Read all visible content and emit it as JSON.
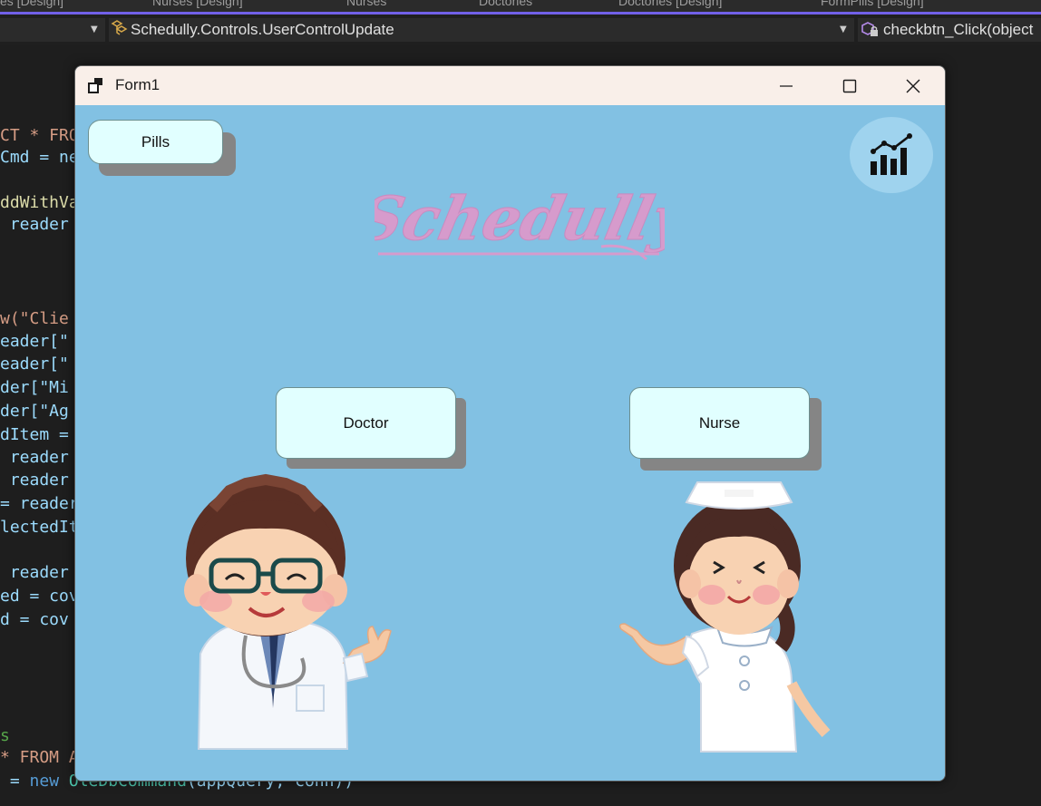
{
  "ide": {
    "tabs": [
      "es [Design]",
      "Nurses [Design]",
      "Nurses",
      "Doctories",
      "Doctories [Design]",
      "FormPills [Design]"
    ],
    "nav": {
      "left_combo": "",
      "middle_combo": "Schedully.Controls.UserControlUpdate",
      "right_combo": "checkbtn_Click(object"
    },
    "code_lines": [
      {
        "text": "CT * FRO",
        "cls": "sql"
      },
      {
        "text": "Cmd = ne",
        "cls": "id"
      },
      {
        "text": "ddWithVa",
        "cls": "fn"
      },
      {
        "text": " reader",
        "cls": "id"
      },
      {
        "text": "w(\"Clie",
        "cls": "str"
      },
      {
        "text": "eader[\"",
        "cls": "id"
      },
      {
        "text": "eader[\"",
        "cls": "id"
      },
      {
        "text": "der[\"Mi",
        "cls": "id"
      },
      {
        "text": "der[\"Ag",
        "cls": "id"
      },
      {
        "text": "dItem =",
        "cls": "id"
      },
      {
        "text": " reader",
        "cls": "id"
      },
      {
        "text": " reader",
        "cls": "id"
      },
      {
        "text": "= reader",
        "cls": "id"
      },
      {
        "text": "lectedIt",
        "cls": "id"
      },
      {
        "text": " reader",
        "cls": "id"
      },
      {
        "text": "ed = cov",
        "cls": "id"
      },
      {
        "text": "d = cov",
        "cls": "id"
      },
      {
        "text": "s",
        "cls": "cm"
      },
      {
        "text": "* FROM A",
        "cls": "sql"
      },
      {
        "text": " = new OleDbCommand(appQuery, conn))",
        "cls": "mixed"
      }
    ]
  },
  "form": {
    "title": "Form1",
    "brand": "Schedully",
    "buttons": {
      "pills": "Pills",
      "doctor": "Doctor",
      "nurse": "Nurse"
    },
    "icons": {
      "window_icon": "form-window-icon",
      "minimize": "minimize-icon",
      "maximize": "maximize-icon",
      "close": "close-icon",
      "stats": "chart-growth-icon"
    },
    "colors": {
      "client_bg": "#82c1e3",
      "button_bg": "#e1ffff",
      "logo": "#d69bcc",
      "titlebar": "#f9efe9"
    }
  }
}
